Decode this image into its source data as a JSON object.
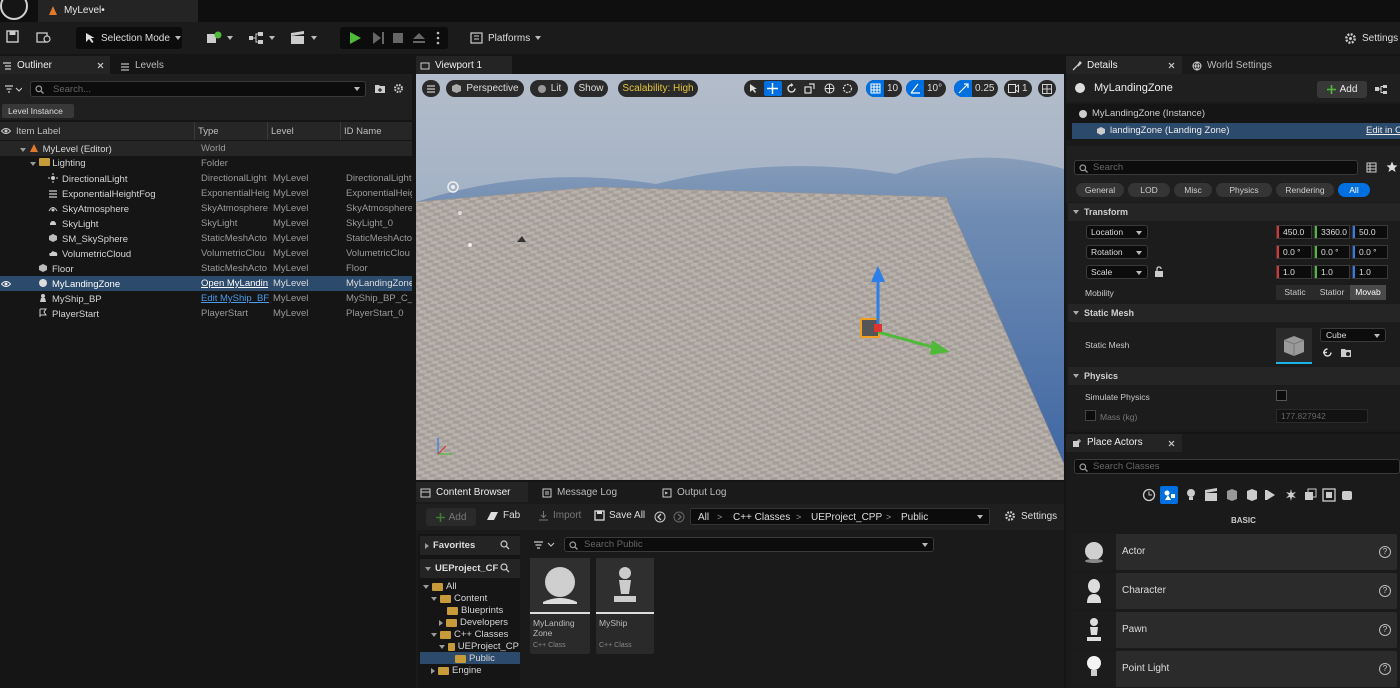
{
  "app": {
    "document_tab": "MyLevel•"
  },
  "toolbar": {
    "selection_mode": "Selection Mode",
    "platforms": "Platforms",
    "settings": "Settings"
  },
  "outliner": {
    "tabs": [
      "Outliner",
      "Levels"
    ],
    "search_placeholder": "Search...",
    "level_instance": "Level Instance",
    "columns": [
      "Item Label",
      "Type",
      "Level",
      "ID Name"
    ],
    "rows": [
      {
        "label": "MyLevel (Editor)",
        "type": "World",
        "level": "",
        "id": ""
      },
      {
        "label": "Lighting",
        "type": "Folder",
        "level": "",
        "id": ""
      },
      {
        "label": "DirectionalLight",
        "type": "DirectionalLight",
        "level": "MyLevel",
        "id": "DirectionalLight"
      },
      {
        "label": "ExponentialHeightFog",
        "type": "ExponentialHeig",
        "level": "MyLevel",
        "id": "ExponentialHeig"
      },
      {
        "label": "SkyAtmosphere",
        "type": "SkyAtmosphere",
        "level": "MyLevel",
        "id": "SkyAtmosphere"
      },
      {
        "label": "SkyLight",
        "type": "SkyLight",
        "level": "MyLevel",
        "id": "SkyLight_0"
      },
      {
        "label": "SM_SkySphere",
        "type": "StaticMeshActo",
        "level": "MyLevel",
        "id": "StaticMeshActo"
      },
      {
        "label": "VolumetricCloud",
        "type": "VolumetricClou",
        "level": "MyLevel",
        "id": "VolumetricClou"
      },
      {
        "label": "Floor",
        "type": "StaticMeshActo",
        "level": "MyLevel",
        "id": "Floor"
      },
      {
        "label": "MyLandingZone",
        "type": "Open MyLandin",
        "level": "MyLevel",
        "id": "MyLandingZone"
      },
      {
        "label": "MyShip_BP",
        "type": "Edit MyShip_BF",
        "level": "MyLevel",
        "id": "MyShip_BP_C_1"
      },
      {
        "label": "PlayerStart",
        "type": "PlayerStart",
        "level": "MyLevel",
        "id": "PlayerStart_0"
      }
    ]
  },
  "viewport": {
    "tab": "Viewport 1",
    "perspective": "Perspective",
    "lit": "Lit",
    "show": "Show",
    "scalability": "Scalability: High",
    "grid_snap": "10",
    "rot_snap": "10°",
    "scale_snap": "0.25",
    "camera_speed": "1"
  },
  "details": {
    "tabs": [
      "Details",
      "World Settings"
    ],
    "actor_name": "MyLandingZone",
    "add": "Add",
    "instance": "MyLandingZone (Instance)",
    "component": "landingZone (Landing Zone)",
    "edit_link": "Edit in C",
    "search": "Search",
    "filters": [
      "General",
      "LOD",
      "Misc",
      "Physics",
      "Rendering",
      "All"
    ],
    "transform": {
      "title": "Transform",
      "location_label": "Location",
      "location": [
        "450.0",
        "3360.0",
        "50.0"
      ],
      "rotation_label": "Rotation",
      "rotation": [
        "0.0 °",
        "0.0 °",
        "0.0 °"
      ],
      "scale_label": "Scale",
      "scale": [
        "1.0",
        "1.0",
        "1.0"
      ],
      "mobility_label": "Mobility",
      "mobility": [
        "Static",
        "Statior",
        "Movab"
      ]
    },
    "static_mesh": {
      "title": "Static Mesh",
      "label": "Static Mesh",
      "value": "Cube"
    },
    "physics": {
      "title": "Physics",
      "simulate": "Simulate Physics",
      "mass_label": "Mass (kg)",
      "mass": "177.827942"
    }
  },
  "place_actors": {
    "tab": "Place Actors",
    "search": "Search Classes",
    "category": "BASIC",
    "items": [
      "Actor",
      "Character",
      "Pawn",
      "Point Light"
    ]
  },
  "content_browser": {
    "tabs": [
      "Content Browser",
      "Message Log",
      "Output Log"
    ],
    "add": "Add",
    "fab": "Fab",
    "import": "Import",
    "save_all": "Save All",
    "path": [
      "All",
      "C++ Classes",
      "UEProject_CPP",
      "Public"
    ],
    "settings": "Settings",
    "favorites": "Favorites",
    "project": "UEProject_CF",
    "search": "Search Public",
    "tree": [
      "All",
      "Content",
      "Blueprints",
      "Developers",
      "C++ Classes",
      "UEProject_CP",
      "Public",
      "Engine"
    ],
    "assets": [
      {
        "name": "MyLanding Zone",
        "kind": "C++ Class"
      },
      {
        "name": "MyShip",
        "kind": "C++ Class"
      }
    ]
  },
  "colors": {
    "accent": "#0070e0",
    "selected_row": "#2c4a6b",
    "play_green": "#4fba3a",
    "scalability": "#e5c53a"
  }
}
